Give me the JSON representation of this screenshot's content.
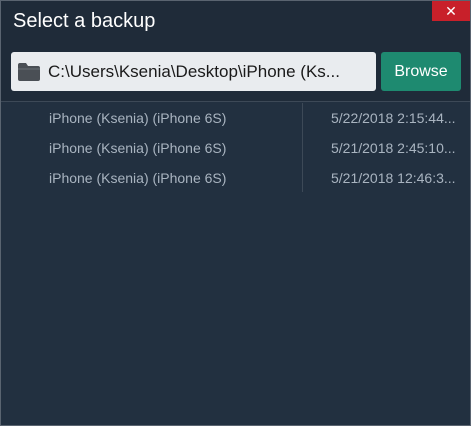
{
  "dialog": {
    "title": "Select a backup",
    "close_glyph": "✕"
  },
  "path_bar": {
    "folder_icon": "folder-icon",
    "path_value": "C:\\Users\\Ksenia\\Desktop\\iPhone (Ks...",
    "browse_label": "Browse"
  },
  "backups": [
    {
      "name": "iPhone (Ksenia) (iPhone 6S)",
      "date": "5/22/2018 2:15:44..."
    },
    {
      "name": "iPhone (Ksenia) (iPhone 6S)",
      "date": "5/21/2018 2:45:10..."
    },
    {
      "name": "iPhone (Ksenia) (iPhone 6S)",
      "date": "5/21/2018 12:46:3..."
    }
  ],
  "colors": {
    "background": "#223040",
    "accent": "#1e8a70",
    "close": "#c8202a"
  }
}
